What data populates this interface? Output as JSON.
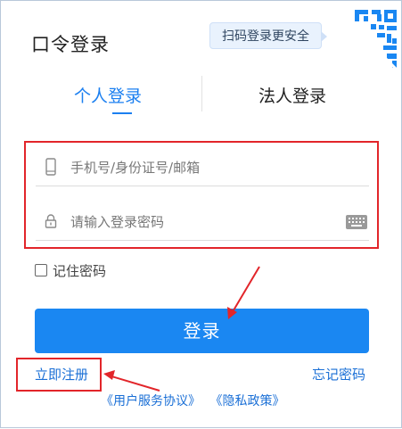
{
  "header": {
    "title": "口令登录",
    "qr_tip": "扫码登录更安全"
  },
  "tabs": [
    {
      "label": "个人登录",
      "active": true
    },
    {
      "label": "法人登录",
      "active": false
    }
  ],
  "form": {
    "account_placeholder": "手机号/身份证号/邮箱",
    "account_value": "",
    "password_placeholder": "请输入登录密码",
    "password_value": "",
    "remember_label": "记住密码",
    "remember_checked": false
  },
  "login_button": "登录",
  "links": {
    "register": "立即注册",
    "forgot": "忘记密码",
    "user_agreement": "《用户服务协议》",
    "privacy_policy": "《隐私政策》"
  },
  "colors": {
    "accent": "#1a87f2",
    "link": "#1a6fd6",
    "highlight_box": "#e2252a",
    "annotation_arrow": "#e2252a"
  },
  "icons": [
    "qr-code-icon",
    "phone-icon",
    "lock-icon",
    "keyboard-icon",
    "checkbox-icon"
  ]
}
